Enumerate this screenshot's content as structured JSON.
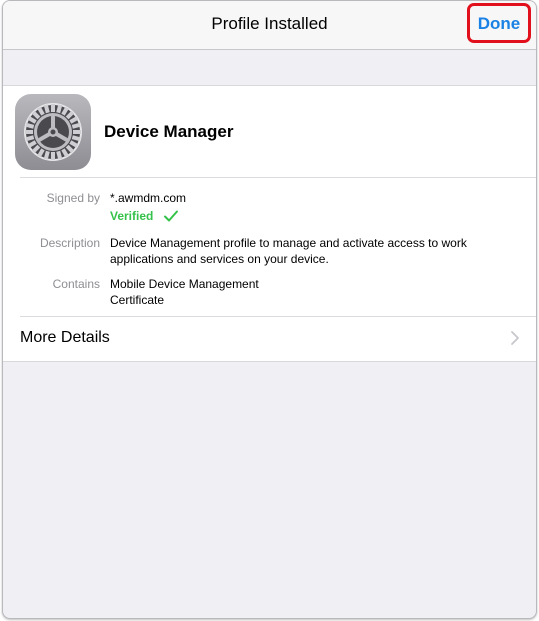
{
  "navbar": {
    "title": "Profile Installed",
    "done_label": "Done"
  },
  "profile": {
    "name": "Device Manager",
    "icon": "settings-gear-icon"
  },
  "details": {
    "signed_by_label": "Signed by",
    "signed_by_value": "*.awmdm.com",
    "verified_label": "Verified",
    "description_label": "Description",
    "description_line1": "Device Management profile to manage and activate access to work",
    "description_line2": "applications and services on your device.",
    "contains_label": "Contains",
    "contains_line1": "Mobile Device Management",
    "contains_line2": "Certificate"
  },
  "more_details": {
    "label": "More Details"
  },
  "colors": {
    "accent": "#1a82e4",
    "verified": "#35c24a",
    "highlight": "#e2101c"
  }
}
